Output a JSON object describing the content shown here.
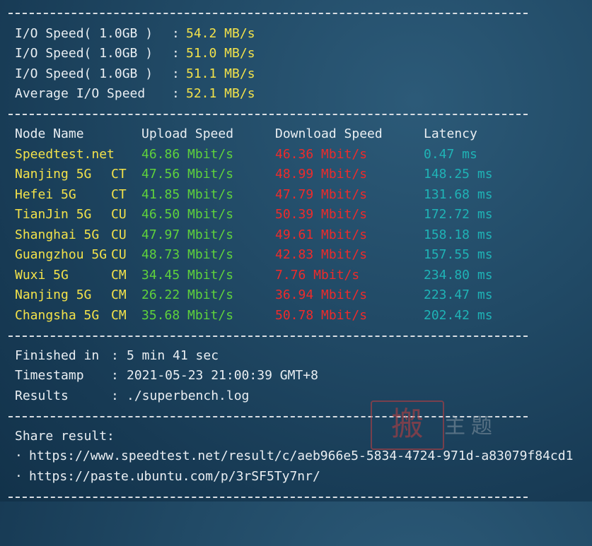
{
  "io": {
    "rows": [
      {
        "label": "I/O Speed( 1.0GB )",
        "sep": ":",
        "value": "54.2 MB/s"
      },
      {
        "label": "I/O Speed( 1.0GB )",
        "sep": ":",
        "value": "51.0 MB/s"
      },
      {
        "label": "I/O Speed( 1.0GB )",
        "sep": ":",
        "value": "51.1 MB/s"
      },
      {
        "label": "Average I/O Speed",
        "sep": ":",
        "value": "52.1 MB/s"
      }
    ]
  },
  "speed": {
    "headers": {
      "node": "Node Name",
      "upload": "Upload Speed",
      "download": "Download Speed",
      "latency": "Latency"
    },
    "rows": [
      {
        "node": "Speedtest.net",
        "isp": "",
        "upload": "46.86 Mbit/s",
        "download": "46.36 Mbit/s",
        "latency": "0.47 ms"
      },
      {
        "node": "Nanjing 5G",
        "isp": "CT",
        "upload": "47.56 Mbit/s",
        "download": "48.99 Mbit/s",
        "latency": "148.25 ms"
      },
      {
        "node": "Hefei 5G",
        "isp": "CT",
        "upload": "41.85 Mbit/s",
        "download": "47.79 Mbit/s",
        "latency": "131.68 ms"
      },
      {
        "node": "TianJin 5G",
        "isp": "CU",
        "upload": "46.50 Mbit/s",
        "download": "50.39 Mbit/s",
        "latency": "172.72 ms"
      },
      {
        "node": "Shanghai 5G",
        "isp": "CU",
        "upload": "47.97 Mbit/s",
        "download": "49.61 Mbit/s",
        "latency": "158.18 ms"
      },
      {
        "node": "Guangzhou 5G",
        "isp": "CU",
        "upload": "48.73 Mbit/s",
        "download": "42.83 Mbit/s",
        "latency": "157.55 ms"
      },
      {
        "node": "Wuxi 5G",
        "isp": "CM",
        "upload": "34.45 Mbit/s",
        "download": "7.76 Mbit/s",
        "latency": "234.80 ms"
      },
      {
        "node": "Nanjing 5G",
        "isp": "CM",
        "upload": "26.22 Mbit/s",
        "download": "36.94 Mbit/s",
        "latency": "223.47 ms"
      },
      {
        "node": "Changsha 5G",
        "isp": "CM",
        "upload": "35.68 Mbit/s",
        "download": "50.78 Mbit/s",
        "latency": "202.42 ms"
      }
    ]
  },
  "summary": {
    "rows": [
      {
        "label": "Finished in",
        "sep": ":",
        "value": "5 min 41 sec"
      },
      {
        "label": "Timestamp",
        "sep": ":",
        "value": "2021-05-23 21:00:39 GMT+8"
      },
      {
        "label": "Results",
        "sep": ":",
        "value": "./superbench.log"
      }
    ]
  },
  "share": {
    "title": "Share result:",
    "bullet": "·",
    "links": [
      "https://www.speedtest.net/result/c/aeb966e5-5834-4724-971d-a83079f84cd1",
      "https://paste.ubuntu.com/p/3rSF5Ty7nr/"
    ]
  },
  "watermark": {
    "seal": "搬",
    "text": "主题"
  },
  "colors": {
    "value_yellow": "#f3e24a",
    "upload_green": "#5fd23c",
    "download_red": "#ee2b2b",
    "latency_teal": "#1fb3b6"
  }
}
